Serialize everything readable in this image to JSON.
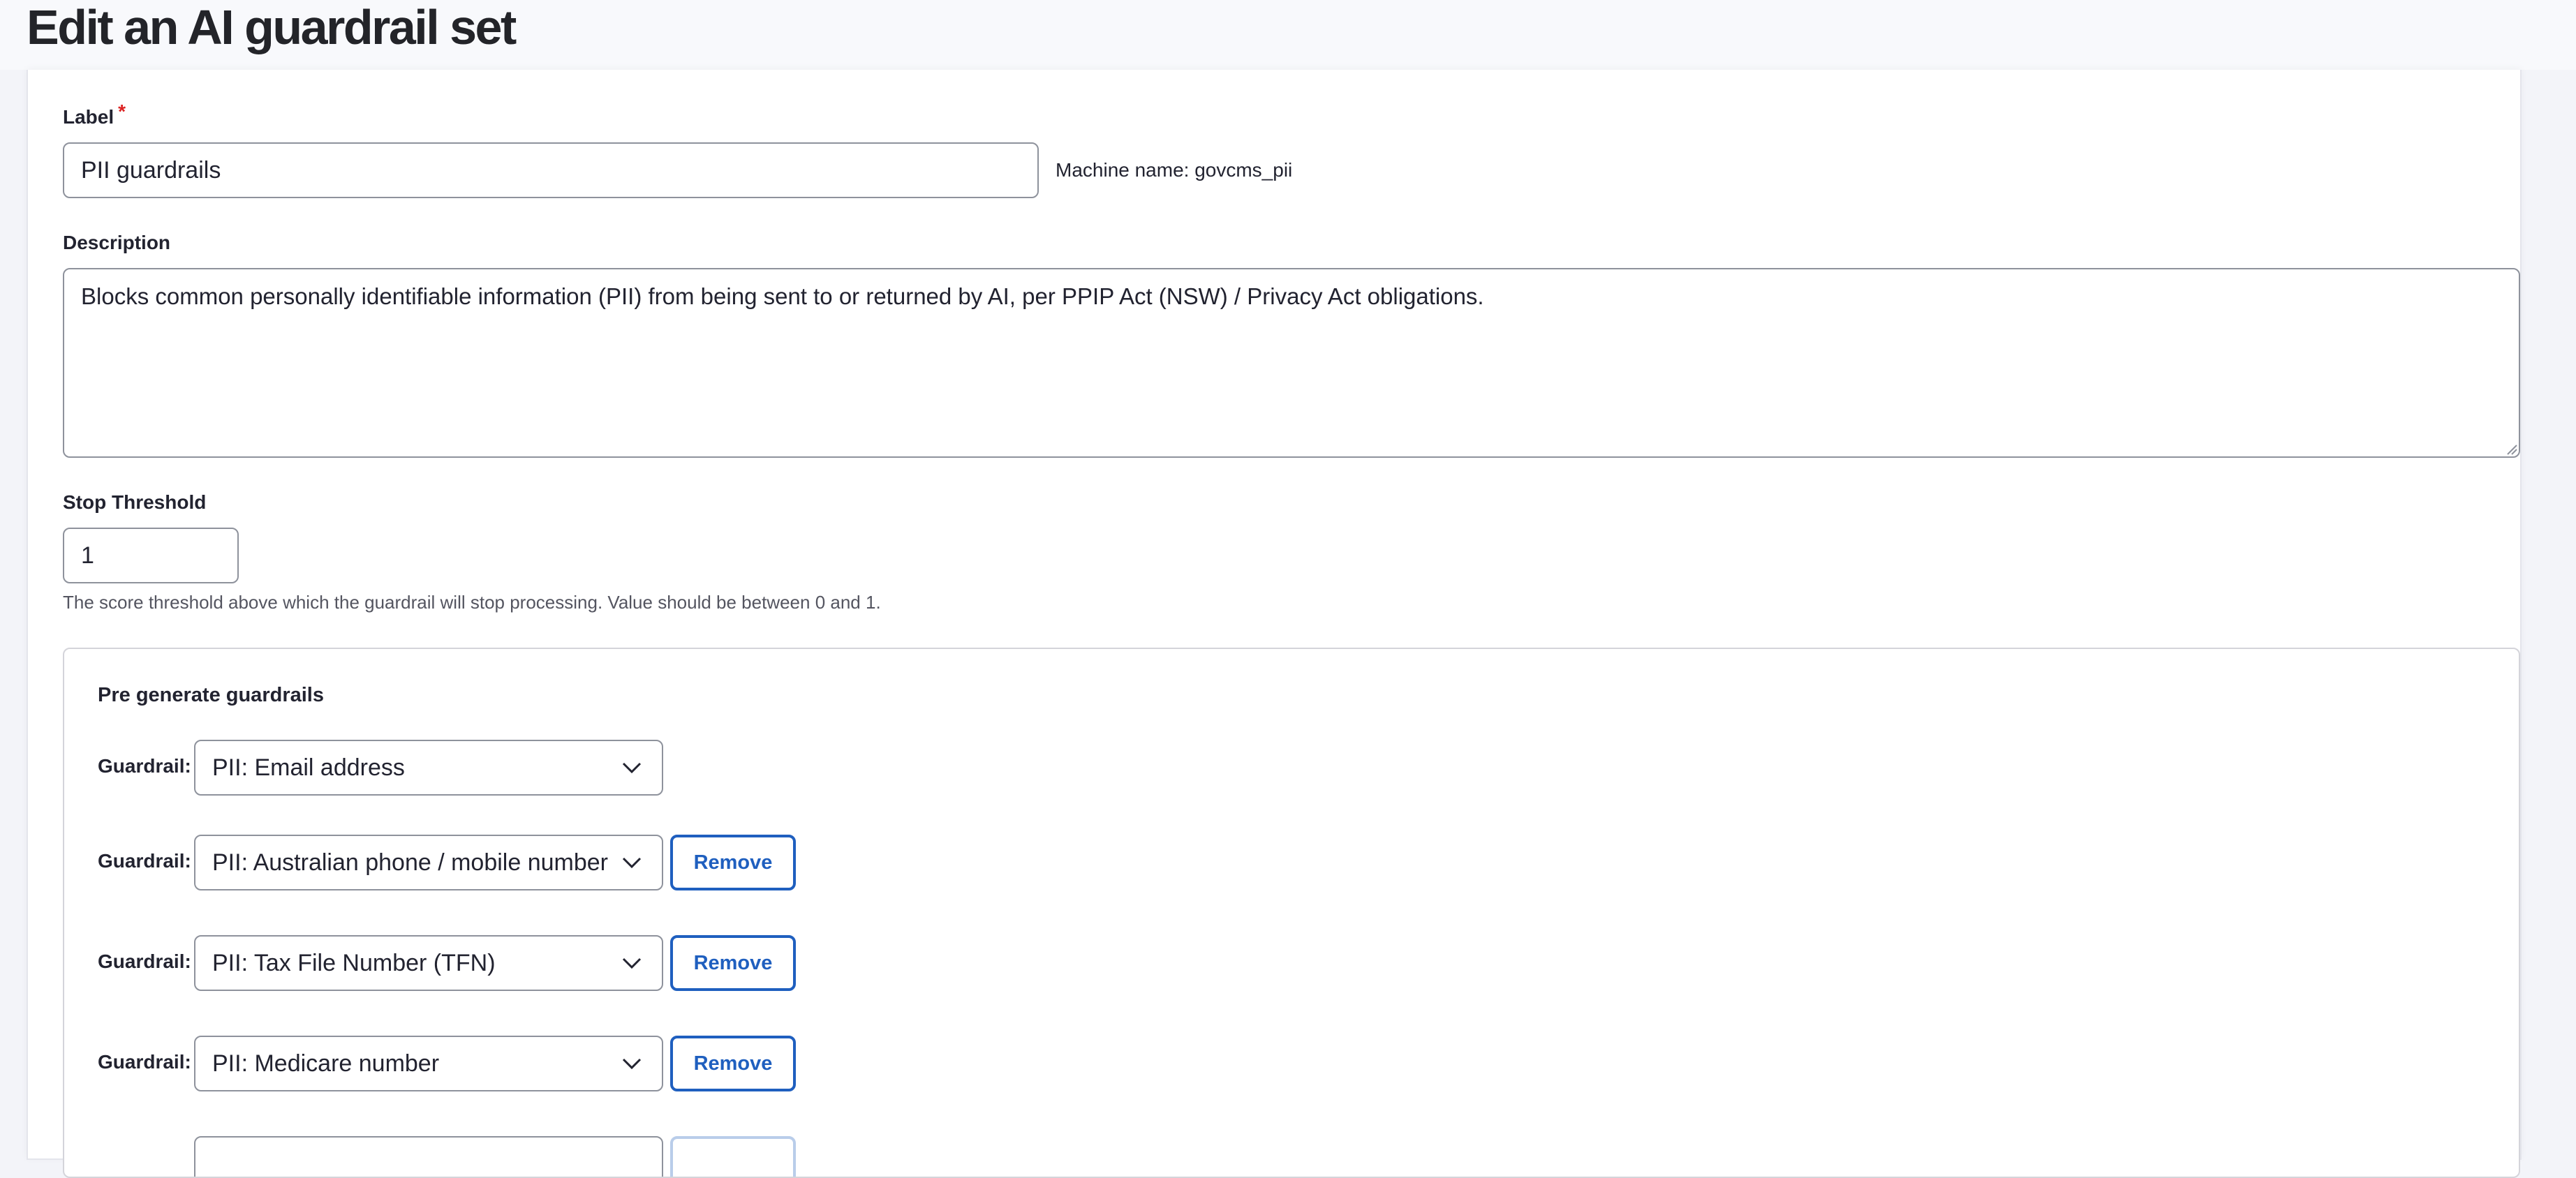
{
  "page": {
    "title": "Edit an AI guardrail set"
  },
  "label_field": {
    "label": "Label",
    "required_marker": "*",
    "value": "PII guardrails",
    "machine_name": "Machine name: govcms_pii"
  },
  "description_field": {
    "label": "Description",
    "value": "Blocks common personally identifiable information (PII) from being sent to or returned by AI, per PPIP Act (NSW) / Privacy Act obligations."
  },
  "stop_threshold": {
    "label": "Stop Threshold",
    "value": "1",
    "help": "The score threshold above which the guardrail will stop processing. Value should be between 0 and 1."
  },
  "pre_generate": {
    "legend": "Pre generate guardrails",
    "remove_label": "Remove",
    "rows": [
      {
        "label": "Guardrail:",
        "selected": "PII: Email address"
      },
      {
        "label": "Guardrail:",
        "selected": "PII: Australian phone / mobile number"
      },
      {
        "label": "Guardrail:",
        "selected": "PII: Tax File Number (TFN)"
      },
      {
        "label": "Guardrail:",
        "selected": "PII: Medicare number"
      }
    ]
  },
  "colors": {
    "accent": "#1f5fbf",
    "required": "#dc2323",
    "border": "#8e929c",
    "page_bg": "#f3f4f9"
  }
}
